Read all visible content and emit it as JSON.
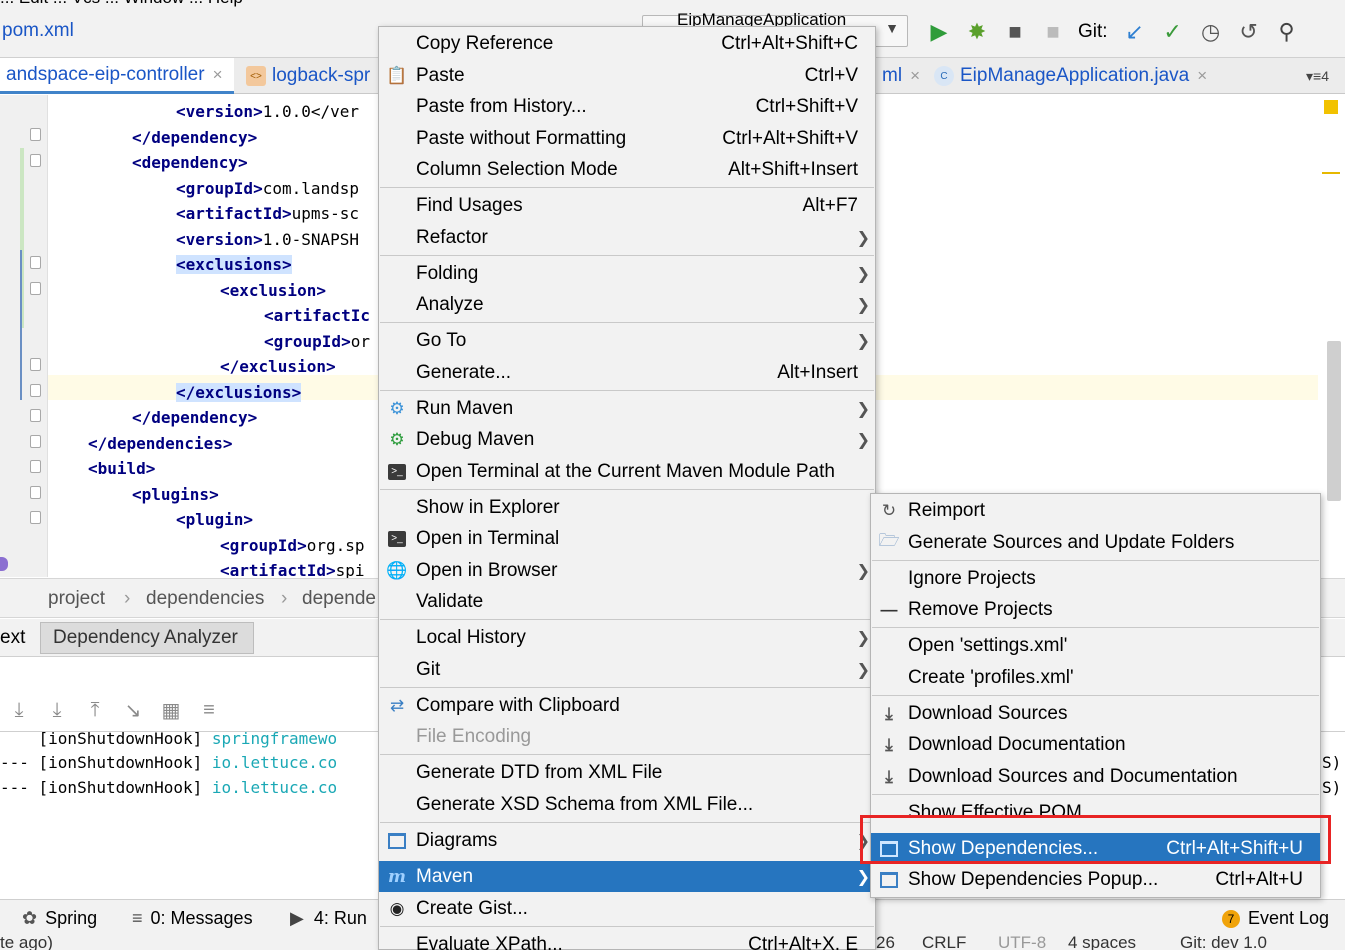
{
  "menubar": {
    "text": "... Edit ... Vcs ... Window ... Help"
  },
  "toolbar": {
    "file_breadcrumb": "pom.xml",
    "run_config": "EipManageApplication",
    "git_label": "Git:"
  },
  "tabs": [
    {
      "label": "andspace-eip-controller",
      "active": true
    },
    {
      "label": "logback-spr",
      "active": false
    },
    {
      "label": "ml",
      "active": false
    },
    {
      "label": "EipManageApplication.java",
      "active": false
    },
    {
      "label": "4",
      "active": false
    }
  ],
  "editor": {
    "lines": [
      {
        "open": "<version>",
        "text": "1.0.0</ver",
        "close": ""
      },
      {
        "open": "</dependency>",
        "text": "",
        "close": ""
      },
      {
        "open": "<dependency>",
        "text": "",
        "close": ""
      },
      {
        "open": "<groupId>",
        "text": "com.landsp",
        "close": ""
      },
      {
        "open": "<artifactId>",
        "text": "upms-sc",
        "close": ""
      },
      {
        "open": "<version>",
        "text": "1.0-SNAPSH",
        "close": ""
      },
      {
        "open": "<exclusions>",
        "text": "",
        "close": ""
      },
      {
        "open": "<exclusion>",
        "text": "",
        "close": ""
      },
      {
        "open": "<artifactIc",
        "text": "",
        "close": ""
      },
      {
        "open": "<groupId>",
        "text": "or",
        "close": ""
      },
      {
        "open": "</exclusion>",
        "text": "",
        "close": ""
      },
      {
        "open": "</exclusions>",
        "text": "",
        "close": ""
      },
      {
        "open": "</dependency>",
        "text": "",
        "close": ""
      },
      {
        "open": "</dependencies>",
        "text": "",
        "close": ""
      },
      {
        "open": "<build>",
        "text": "",
        "close": ""
      },
      {
        "open": "<plugins>",
        "text": "",
        "close": ""
      },
      {
        "open": "<plugin>",
        "text": "",
        "close": ""
      },
      {
        "open": "<groupId>",
        "text": "org.sp",
        "close": ""
      },
      {
        "open": "<artifactId>",
        "text": "spi",
        "close": ""
      }
    ]
  },
  "breadcrumb": {
    "items": [
      "project",
      "dependencies",
      "depende"
    ]
  },
  "toolwindow": {
    "tab_text": "ext",
    "tab_dependency": "Dependency Analyzer",
    "log": [
      {
        "prefix": "    [ionShutdownHook] ",
        "link": "springframewo"
      },
      {
        "prefix": "--- [ionShutdownHook] ",
        "link": "io.lettuce.co"
      },
      {
        "prefix": "--- [ionShutdownHook] ",
        "link": "io.lettuce.co"
      }
    ],
    "log_right": [
      "S)",
      "S)"
    ]
  },
  "bottombar": {
    "spring": "Spring",
    "messages": "0: Messages",
    "run": "4: Run",
    "event_log": "Event Log",
    "event_count": "7"
  },
  "statusbar": {
    "left": "te ago)",
    "position": "26",
    "line_sep": "CRLF",
    "encoding": "UTF-8",
    "indent": "4 spaces",
    "git": "Git: dev 1.0"
  },
  "context_menu": {
    "items": [
      {
        "label": "Copy Reference",
        "shortcut": "Ctrl+Alt+Shift+C"
      },
      {
        "label": "Paste",
        "shortcut": "Ctrl+V",
        "icon": "clipboard-icon"
      },
      {
        "label": "Paste from History...",
        "shortcut": "Ctrl+Shift+V"
      },
      {
        "label": "Paste without Formatting",
        "shortcut": "Ctrl+Alt+Shift+V"
      },
      {
        "label": "Column Selection Mode",
        "shortcut": "Alt+Shift+Insert"
      },
      {
        "label": "Find Usages",
        "shortcut": "Alt+F7"
      },
      {
        "label": "Refactor",
        "submenu": true
      },
      {
        "label": "Folding",
        "submenu": true
      },
      {
        "label": "Analyze",
        "submenu": true
      },
      {
        "label": "Go To",
        "submenu": true
      },
      {
        "label": "Generate...",
        "shortcut": "Alt+Insert"
      },
      {
        "label": "Run Maven",
        "submenu": true,
        "icon": "gear-icon"
      },
      {
        "label": "Debug Maven",
        "submenu": true,
        "icon": "gear-icon"
      },
      {
        "label": "Open Terminal at the Current Maven Module Path",
        "icon": "terminal-icon"
      },
      {
        "label": "Show in Explorer"
      },
      {
        "label": "Open in Terminal",
        "icon": "terminal-icon"
      },
      {
        "label": "Open in Browser",
        "submenu": true,
        "icon": "globe-icon"
      },
      {
        "label": "Validate"
      },
      {
        "label": "Local History",
        "submenu": true
      },
      {
        "label": "Git",
        "submenu": true
      },
      {
        "label": "Compare with Clipboard",
        "icon": "compare-icon"
      },
      {
        "label": "File Encoding",
        "disabled": true
      },
      {
        "label": "Generate DTD from XML File"
      },
      {
        "label": "Generate XSD Schema from XML File..."
      },
      {
        "label": "Diagrams",
        "submenu": true,
        "icon": "diagram-icon"
      },
      {
        "label": "Maven",
        "submenu": true,
        "selected": true,
        "icon": "maven-icon"
      },
      {
        "label": "Create Gist...",
        "icon": "github-icon"
      },
      {
        "label": "Evaluate XPath...",
        "shortcut": "Ctrl+Alt+X, E"
      }
    ]
  },
  "maven_submenu": {
    "items": [
      {
        "label": "Reimport",
        "icon": "refresh-icon"
      },
      {
        "label": "Generate Sources and Update Folders",
        "icon": "folder-sync-icon"
      },
      {
        "label": "Ignore Projects"
      },
      {
        "label": "Remove Projects",
        "icon": "minus-icon"
      },
      {
        "label": "Open 'settings.xml'"
      },
      {
        "label": "Create 'profiles.xml'"
      },
      {
        "label": "Download Sources",
        "icon": "download-icon"
      },
      {
        "label": "Download Documentation",
        "icon": "download-icon"
      },
      {
        "label": "Download Sources and Documentation",
        "icon": "download-icon"
      },
      {
        "label": "Show Effective POM"
      },
      {
        "label": "Show Dependencies...",
        "shortcut": "Ctrl+Alt+Shift+U",
        "selected": true,
        "icon": "diagram-icon"
      },
      {
        "label": "Show Dependencies Popup...",
        "shortcut": "Ctrl+Alt+U",
        "icon": "diagram-icon"
      }
    ]
  },
  "colors": {
    "selection": "#2675bf",
    "highlight_box": "#e82424",
    "xml_tag": "#000080",
    "link": "#1aa8b5"
  }
}
